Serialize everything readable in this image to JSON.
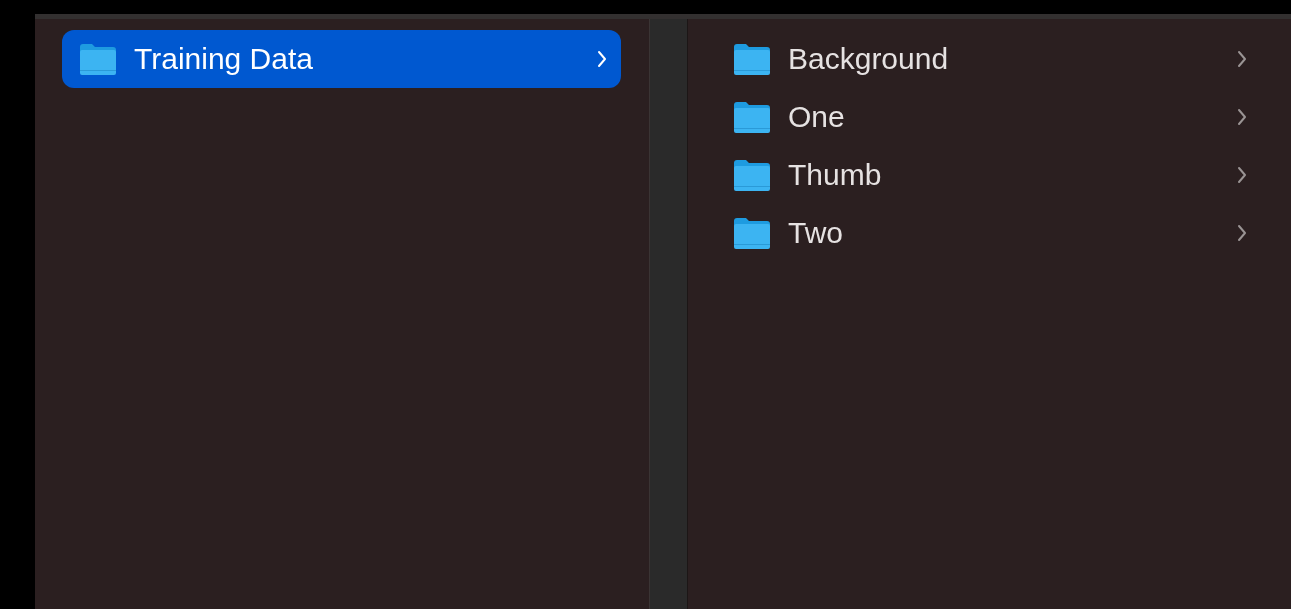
{
  "columns": [
    {
      "items": [
        {
          "name": "Training Data",
          "selected": true
        }
      ]
    },
    {
      "items": [
        {
          "name": "Background",
          "selected": false
        },
        {
          "name": "One",
          "selected": false
        },
        {
          "name": "Thumb",
          "selected": false
        },
        {
          "name": "Two",
          "selected": false
        }
      ]
    }
  ]
}
